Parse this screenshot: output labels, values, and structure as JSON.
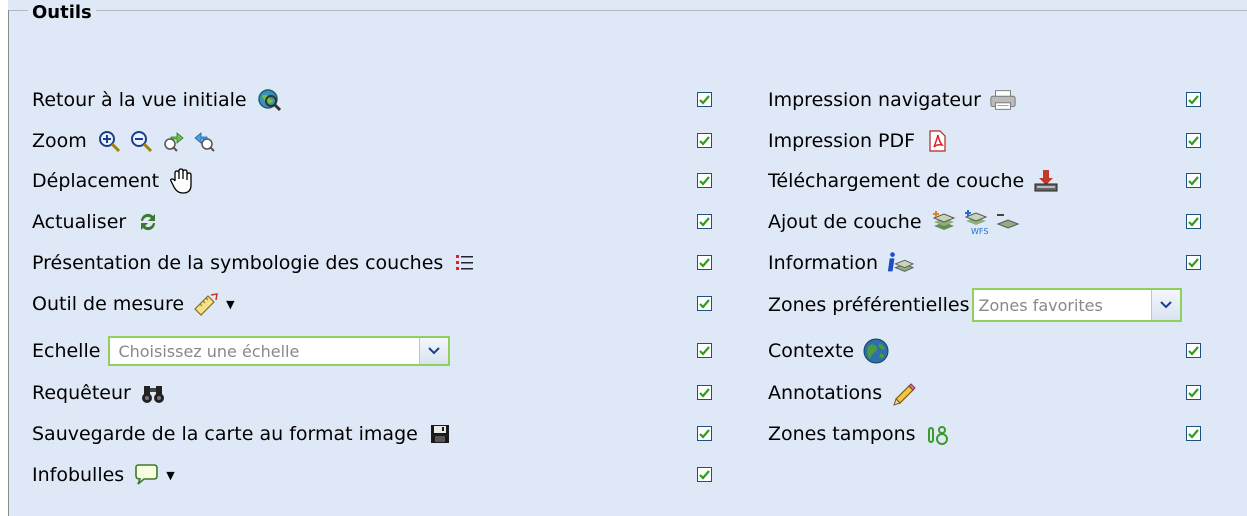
{
  "panel": {
    "title": "Outils"
  },
  "left_items": [
    {
      "label": "Retour à la vue initiale",
      "checked": true
    },
    {
      "label": "Zoom",
      "checked": true
    },
    {
      "label": "Déplacement",
      "checked": true
    },
    {
      "label": "Actualiser",
      "checked": true
    },
    {
      "label": "Présentation de la symbologie des couches",
      "checked": true
    },
    {
      "label": "Outil de mesure",
      "checked": true
    },
    {
      "label": "Echelle",
      "checked": true,
      "select_placeholder": "Choisissez une échelle"
    },
    {
      "label": "Requêteur",
      "checked": true
    },
    {
      "label": "Sauvegarde de la carte au format image",
      "checked": true
    },
    {
      "label": "Infobulles",
      "checked": true
    }
  ],
  "right_items": [
    {
      "label": "Impression navigateur",
      "checked": true
    },
    {
      "label": "Impression PDF",
      "checked": true
    },
    {
      "label": "Téléchargement de couche",
      "checked": true
    },
    {
      "label": "Ajout de couche",
      "checked": true
    },
    {
      "label": "Information",
      "checked": true
    },
    {
      "label": "Zones préférentielles",
      "checked": false,
      "select_value": "Zones favorites"
    },
    {
      "label": "Contexte",
      "checked": true
    },
    {
      "label": "Annotations",
      "checked": true
    },
    {
      "label": "Zones tampons",
      "checked": true
    }
  ],
  "colors": {
    "panel_bg": "#dfe8f6",
    "check": "#2e9e1c",
    "combo_border": "#8fd15c"
  }
}
